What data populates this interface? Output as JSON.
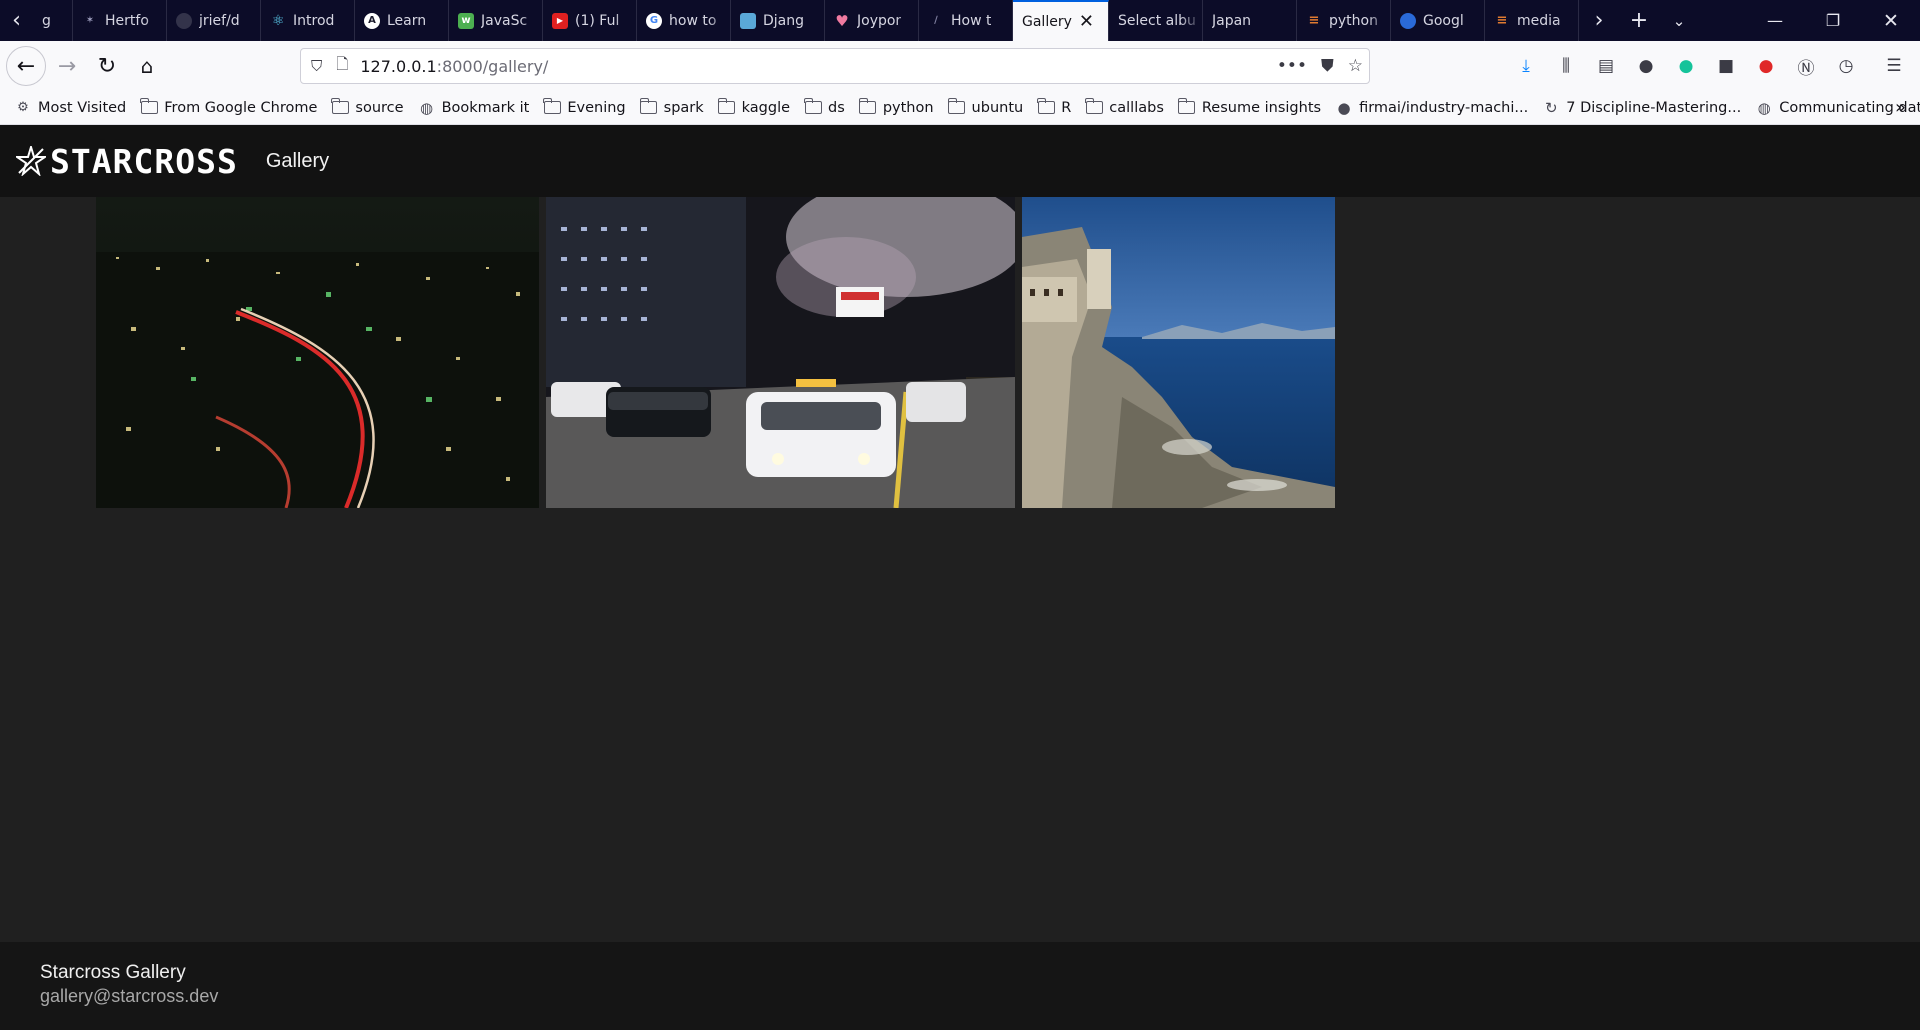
{
  "browser": {
    "tabs": [
      {
        "label": "g",
        "favicon_color": "#6a6a80"
      },
      {
        "label": "Hertfo",
        "favicon_color": "#33334a"
      },
      {
        "label": "jrief/d",
        "favicon_color": "#33334a"
      },
      {
        "label": "Introd",
        "favicon_color": "#3aa0c0"
      },
      {
        "label": "Learn",
        "favicon_color": "#1d1d2e"
      },
      {
        "label": "JavaSc",
        "favicon_color": "#4caf50"
      },
      {
        "label": "(1) Ful",
        "favicon_color": "#e02020"
      },
      {
        "label": "how to",
        "favicon_color": "#ffffff"
      },
      {
        "label": "Djang",
        "favicon_color": "#5aa8d8"
      },
      {
        "label": "Joypor",
        "favicon_color": "#f07aa0"
      },
      {
        "label": "How t",
        "favicon_color": "#33334a"
      }
    ],
    "active_tab": {
      "label": "Gallery"
    },
    "tabs_after": [
      {
        "label": "Select albu"
      },
      {
        "label": "Japan"
      },
      {
        "label": "python",
        "favicon_color": "#e07a30"
      },
      {
        "label": "Googl",
        "favicon_color": "#2a6ad8"
      },
      {
        "label": "media",
        "favicon_color": "#e07a30"
      }
    ],
    "url": {
      "host": "127.0.0.1",
      "rest": ":8000/gallery/"
    },
    "bookmarks": [
      {
        "label": "Most Visited",
        "icon": "gear-icon"
      },
      {
        "label": "From Google Chrome",
        "icon": "folder-icon"
      },
      {
        "label": "source",
        "icon": "folder-icon"
      },
      {
        "label": "Bookmark it",
        "icon": "globe-icon"
      },
      {
        "label": "Evening",
        "icon": "folder-icon"
      },
      {
        "label": "spark",
        "icon": "folder-icon"
      },
      {
        "label": "kaggle",
        "icon": "folder-icon"
      },
      {
        "label": "ds",
        "icon": "folder-icon"
      },
      {
        "label": "python",
        "icon": "folder-icon"
      },
      {
        "label": "ubuntu",
        "icon": "folder-icon"
      },
      {
        "label": "R",
        "icon": "folder-icon"
      },
      {
        "label": "calllabs",
        "icon": "folder-icon"
      },
      {
        "label": "Resume insights",
        "icon": "folder-icon"
      },
      {
        "label": "firmai/industry-machi...",
        "icon": "github-icon"
      },
      {
        "label": "7 Discipline-Mastering...",
        "icon": "refresh-icon"
      },
      {
        "label": "Communicating data s...",
        "icon": "globe-icon"
      }
    ]
  },
  "site": {
    "logo": "STARCROSS",
    "nav_link": "Gallery",
    "photos": [
      {
        "name": "photo-night-city-highway"
      },
      {
        "name": "photo-tokyo-taxis-cherry-blossom"
      },
      {
        "name": "photo-coastal-cliff-fortress"
      }
    ],
    "footer_title": "Starcross Gallery",
    "footer_email": "gallery@starcross.dev"
  }
}
